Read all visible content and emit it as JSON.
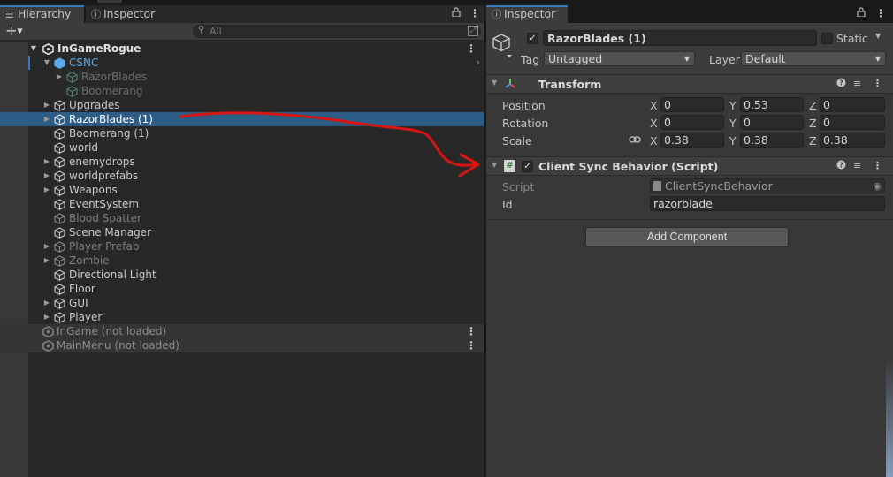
{
  "colors": {
    "selection": "#2c5d87",
    "accent_tab": "#3a79bb",
    "prefab_cube": "#5aa8e8",
    "annotation_arrow": "#d81414"
  },
  "hierarchy": {
    "tab_label": "Hierarchy",
    "inspector_tab_label": "Inspector",
    "search_placeholder": "All",
    "rows": [
      {
        "label": "InGameRogue",
        "depth": 0,
        "type": "scene-root",
        "expand": "open",
        "style": "bold"
      },
      {
        "label": "CSNC",
        "depth": 1,
        "type": "prefab",
        "expand": "open",
        "style": "prefab"
      },
      {
        "label": "RazorBlades",
        "depth": 2,
        "type": "prefab-disabled",
        "expand": "closed",
        "style": "disabled"
      },
      {
        "label": "Boomerang",
        "depth": 2,
        "type": "prefab-disabled",
        "expand": "none",
        "style": "disabled"
      },
      {
        "label": "Upgrades",
        "depth": 1,
        "type": "object",
        "expand": "closed",
        "style": "normal"
      },
      {
        "label": "RazorBlades (1)",
        "depth": 1,
        "type": "object",
        "expand": "closed",
        "style": "selected"
      },
      {
        "label": "Boomerang (1)",
        "depth": 1,
        "type": "object",
        "expand": "none",
        "style": "normal"
      },
      {
        "label": "world",
        "depth": 1,
        "type": "object",
        "expand": "none",
        "style": "normal"
      },
      {
        "label": "enemydrops",
        "depth": 1,
        "type": "object",
        "expand": "closed",
        "style": "normal"
      },
      {
        "label": "worldprefabs",
        "depth": 1,
        "type": "object",
        "expand": "closed",
        "style": "normal"
      },
      {
        "label": "Weapons",
        "depth": 1,
        "type": "object",
        "expand": "closed",
        "style": "normal"
      },
      {
        "label": "EventSystem",
        "depth": 1,
        "type": "object",
        "expand": "none",
        "style": "normal"
      },
      {
        "label": "Blood Spatter",
        "depth": 1,
        "type": "object",
        "expand": "none",
        "style": "dim"
      },
      {
        "label": "Scene Manager",
        "depth": 1,
        "type": "object",
        "expand": "none",
        "style": "normal"
      },
      {
        "label": "Player Prefab",
        "depth": 1,
        "type": "object",
        "expand": "closed",
        "style": "dim"
      },
      {
        "label": "Zombie",
        "depth": 1,
        "type": "object",
        "expand": "closed",
        "style": "dim"
      },
      {
        "label": "Directional Light",
        "depth": 1,
        "type": "object",
        "expand": "none",
        "style": "normal"
      },
      {
        "label": "Floor",
        "depth": 1,
        "type": "object",
        "expand": "none",
        "style": "normal"
      },
      {
        "label": "GUI",
        "depth": 1,
        "type": "object",
        "expand": "closed",
        "style": "normal"
      },
      {
        "label": "Player",
        "depth": 1,
        "type": "object",
        "expand": "closed",
        "style": "normal"
      },
      {
        "label": "InGame (not loaded)",
        "depth": 0,
        "type": "scene",
        "expand": "none",
        "style": "scene"
      },
      {
        "label": "MainMenu (not loaded)",
        "depth": 0,
        "type": "scene",
        "expand": "none",
        "style": "scene"
      }
    ]
  },
  "inspector": {
    "tab_label": "Inspector",
    "object_name": "RazorBlades (1)",
    "active": true,
    "static_label": "Static",
    "tag_label": "Tag",
    "tag_value": "Untagged",
    "layer_label": "Layer",
    "layer_value": "Default",
    "transform": {
      "title": "Transform",
      "position": {
        "label": "Position",
        "x": "0",
        "y": "0.53",
        "z": "0"
      },
      "rotation": {
        "label": "Rotation",
        "x": "0",
        "y": "0",
        "z": "0"
      },
      "scale": {
        "label": "Scale",
        "x": "0.38",
        "y": "0.38",
        "z": "0.38"
      }
    },
    "script_component": {
      "title": "Client Sync Behavior (Script)",
      "enabled": true,
      "script_label": "Script",
      "script_value": "ClientSyncBehavior",
      "id_label": "Id",
      "id_value": "razorblade"
    },
    "add_component_label": "Add Component"
  },
  "axis_labels": {
    "x": "X",
    "y": "Y",
    "z": "Z"
  },
  "icons": [
    "hierarchy-icon",
    "info-icon",
    "lock-icon",
    "menu-dots-icon",
    "plus-icon",
    "search-icon",
    "gameobject-cube-icon",
    "prefab-cube-icon",
    "unity-scene-icon",
    "transform-axes-icon",
    "help-icon",
    "preset-sliders-icon",
    "script-hash-icon",
    "link-icon",
    "object-picker-icon"
  ]
}
